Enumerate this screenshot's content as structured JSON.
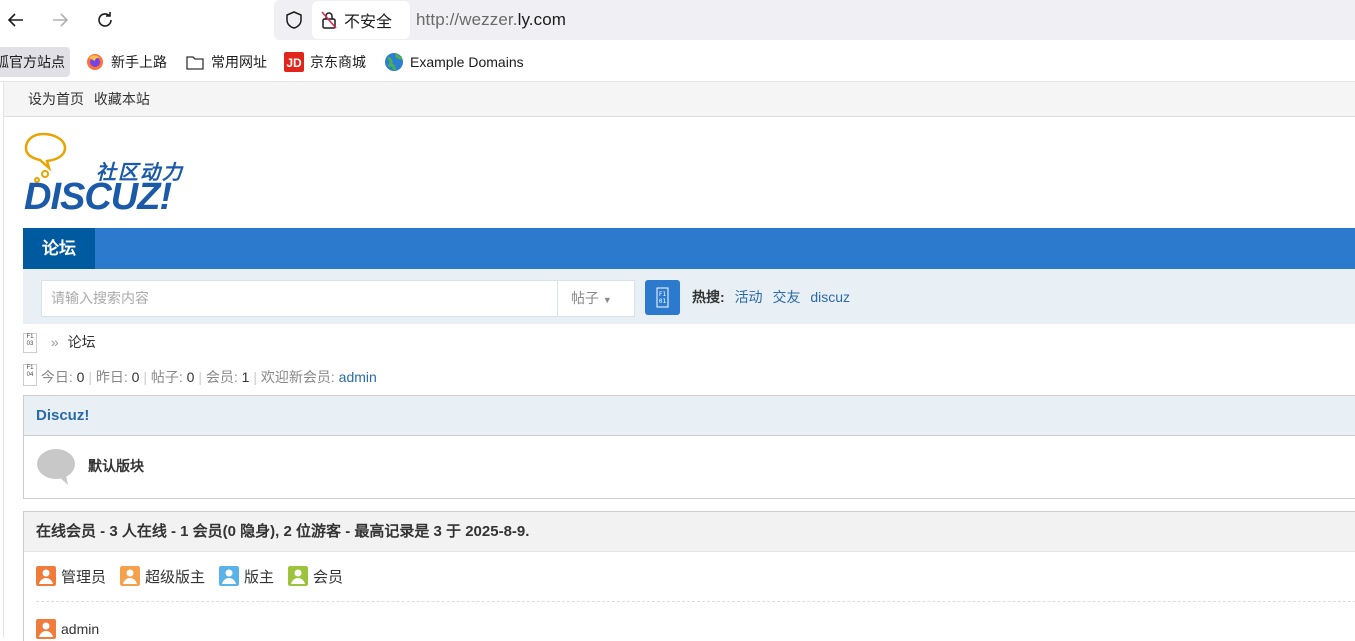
{
  "browser": {
    "insecure_label": "不安全",
    "url_prefix": "http://wezzer.",
    "url_domain": "ly.com"
  },
  "bookmarks": [
    {
      "label": "狐官方站点"
    },
    {
      "label": "新手上路"
    },
    {
      "label": "常用网址"
    },
    {
      "label": "京东商城"
    },
    {
      "label": "Example Domains"
    }
  ],
  "topbar": {
    "set_home": "设为首页",
    "bookmark": "收藏本站"
  },
  "logo": {
    "slogan": "社区动力",
    "brand": "DISCUZ!"
  },
  "nav": {
    "forum": "论坛"
  },
  "search": {
    "placeholder": "请输入搜索内容",
    "type": "帖子",
    "hot_label": "热搜:",
    "hot": [
      "活动",
      "交友",
      "discuz"
    ]
  },
  "breadcrumb": {
    "sep": "»",
    "current": "论坛"
  },
  "stats": {
    "today_label": "今日:",
    "today": "0",
    "yesterday_label": "昨日:",
    "yesterday": "0",
    "posts_label": "帖子:",
    "posts": "0",
    "members_label": "会员:",
    "members": "1",
    "new_member_label": "欢迎新会员:",
    "new_member": "admin"
  },
  "forum_group": {
    "title": "Discuz!",
    "forum_name": "默认版块"
  },
  "online": {
    "title": "在线会员 - 3 人在线 - 1 会员(0 隐身), 2 位游客 - 最高记录是 3 于 2025-8-9.",
    "legend": [
      {
        "label": "管理员",
        "color": "#f07b3a"
      },
      {
        "label": "超级版主",
        "color": "#f5a04a"
      },
      {
        "label": "版主",
        "color": "#5ab3e8"
      },
      {
        "label": "会员",
        "color": "#9bc33b"
      }
    ],
    "users": [
      "admin"
    ]
  }
}
